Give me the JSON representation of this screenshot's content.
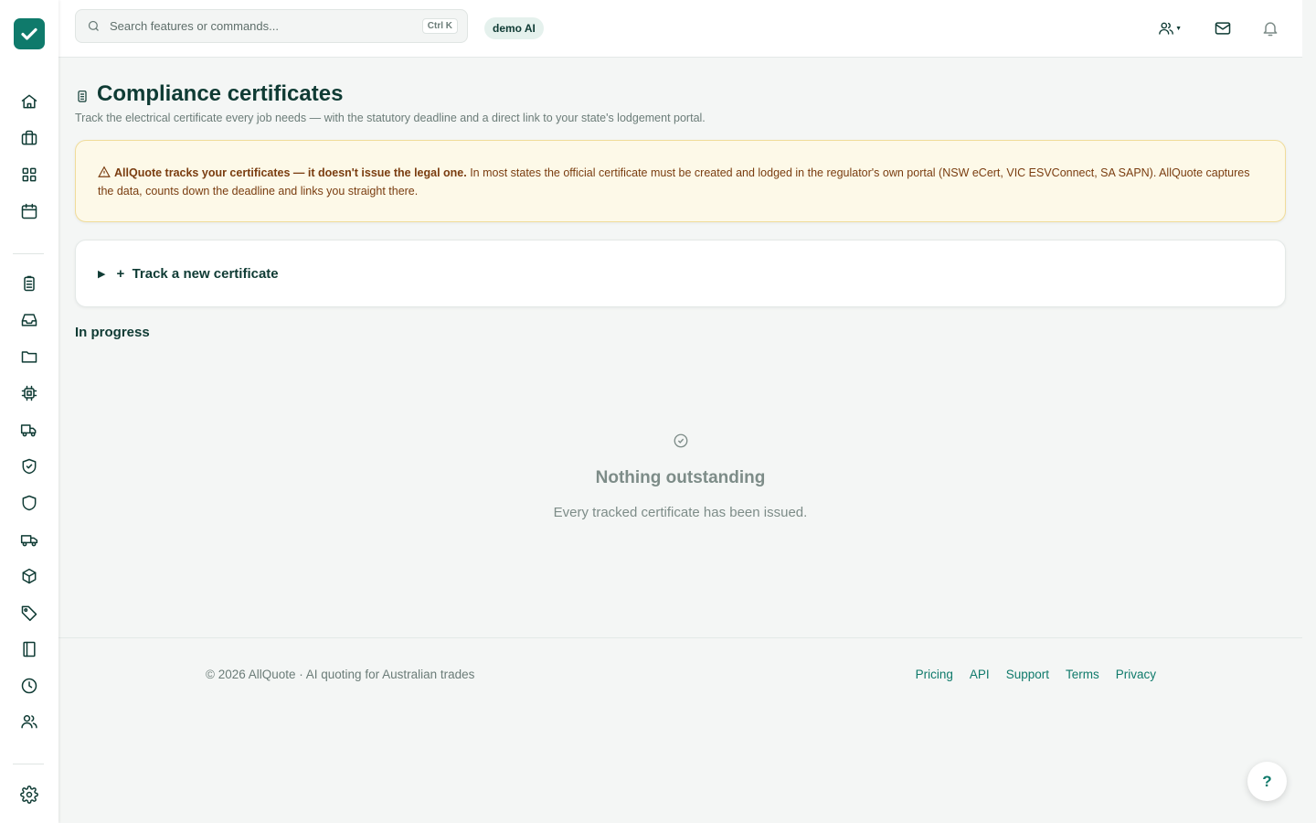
{
  "search": {
    "placeholder": "Search features or commands...",
    "shortcut": "Ctrl K"
  },
  "header": {
    "badge": "demo AI",
    "icons": [
      "team-icon",
      "mail-icon",
      "bell-icon"
    ]
  },
  "sidebar": {
    "icons": [
      "home-icon",
      "briefcase-icon",
      "grid-icon",
      "calendar-icon",
      "clipboard-icon",
      "inbox-icon",
      "folder-icon",
      "chip-icon",
      "truck-icon",
      "shield-check-icon",
      "shield-icon",
      "van-icon",
      "box-icon",
      "tag-icon",
      "book-icon",
      "clock-icon",
      "users-icon",
      "settings-icon"
    ]
  },
  "page": {
    "title": "Compliance certificates",
    "subtitle": "Track the electrical certificate every job needs — with the statutory deadline and a direct link to your state's lodgement portal."
  },
  "warning": {
    "bold": "AllQuote tracks your certificates — it doesn't issue the legal one.",
    "text": " In most states the official certificate must be created and lodged in the regulator's own portal (NSW eCert, VIC ESVConnect, SA SAPN). AllQuote captures the data, counts down the deadline and links you straight there."
  },
  "track": {
    "label": "+  Track a new certificate"
  },
  "section": {
    "heading": "In progress"
  },
  "empty": {
    "title": "Nothing outstanding",
    "subtitle": "Every tracked certificate has been issued."
  },
  "footer": {
    "copyright": "© 2026 AllQuote · AI quoting for Australian trades",
    "links": [
      "Pricing",
      "API",
      "Support",
      "Terms",
      "Privacy"
    ]
  },
  "help": {
    "label": "?"
  },
  "colors": {
    "brand": "#0f7a6b",
    "ink": "#0f3b34",
    "warning_bg": "#fdf9e8"
  }
}
